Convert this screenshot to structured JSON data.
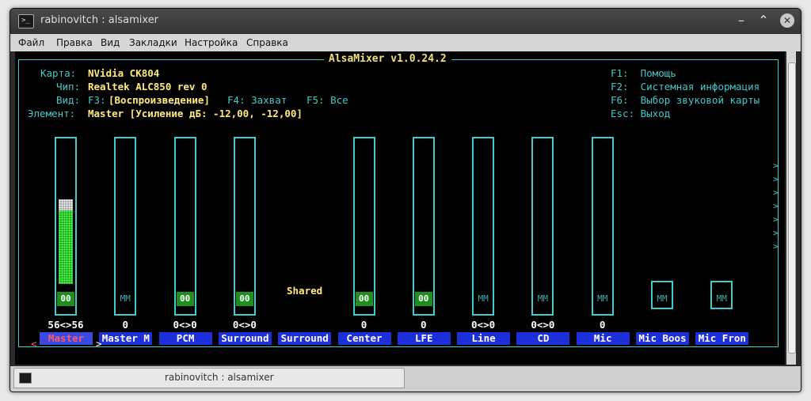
{
  "window": {
    "title": "rabinovitch : alsamixer"
  },
  "menu": [
    "Файл",
    "Правка",
    "Вид",
    "Закладки",
    "Настройка",
    "Справка"
  ],
  "mixer": {
    "header": "AlsaMixer v1.0.24.2",
    "card_label": "Карта:",
    "card_value": "NVidia CK804",
    "chip_label": "Чип:",
    "chip_value": "Realtek ALC850 rev 0",
    "view_label": "Вид:",
    "view_f3": "F3:",
    "view_playback": "[Воспроизведение]",
    "view_f4": "F4: Захват",
    "view_f5": "F5: Все",
    "element_label": "Элемент:",
    "element_value": "Master [Усиление дБ: -12,00, -12,00]",
    "help": [
      "F1:  Помощь",
      "F2:  Системная информация",
      "F6:  Выбор звуковой карты",
      "Esc: Выход"
    ],
    "shared_label": "Shared",
    "sel_left": "<",
    "sel_right": ">",
    "arrows": [
      ">",
      ">",
      ">",
      ">",
      ">",
      ">",
      ">"
    ]
  },
  "channels": [
    {
      "name": "Master",
      "value": "56<>56",
      "mute": "00",
      "level": 0.56,
      "selected": true
    },
    {
      "name": "Master M",
      "value": "0",
      "mute": "MM",
      "level": 0
    },
    {
      "name": "PCM",
      "value": "0<>0",
      "mute": "00",
      "level": 0
    },
    {
      "name": "Surround",
      "value": "0<>0",
      "mute": "00",
      "level": 0
    },
    {
      "name": "Surround",
      "value": "",
      "mute": "",
      "level": 0,
      "shared": true
    },
    {
      "name": "Center",
      "value": "0",
      "mute": "00",
      "level": 0
    },
    {
      "name": "LFE",
      "value": "0",
      "mute": "00",
      "level": 0
    },
    {
      "name": "Line",
      "value": "0<>0",
      "mute": "MM",
      "level": 0
    },
    {
      "name": "CD",
      "value": "0<>0",
      "mute": "MM",
      "level": 0
    },
    {
      "name": "Mic",
      "value": "0",
      "mute": "MM",
      "level": 0
    },
    {
      "name": "Mic Boos",
      "value": "",
      "mute": "MM",
      "level": 0,
      "switch_only": true
    },
    {
      "name": "Mic Fron",
      "value": "",
      "mute": "MM",
      "level": 0,
      "switch_only": true
    }
  ],
  "tab": {
    "label": "rabinovitch : alsamixer"
  }
}
